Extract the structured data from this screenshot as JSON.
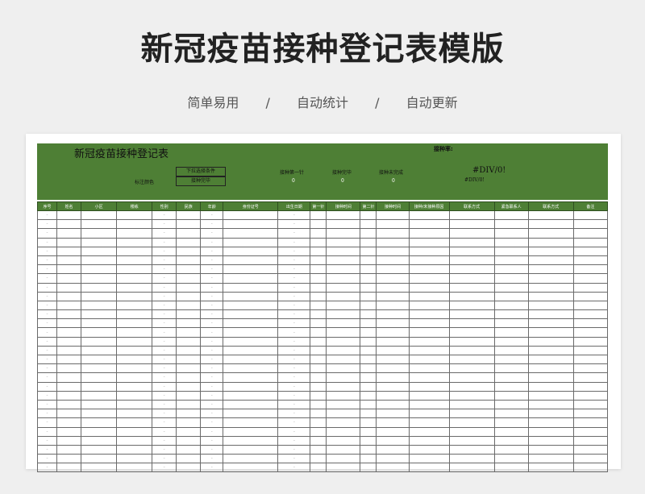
{
  "hero": {
    "title": "新冠疫苗接种登记表模版",
    "features": [
      "简单易用",
      "/",
      "自动统计",
      "/",
      "自动更新"
    ]
  },
  "sheet": {
    "title": "新冠疫苗接种登记表",
    "rate_label": "接种率:",
    "filter_label": "下拉选择条件",
    "mark_label": "标注颜色",
    "status_value": "接种完毕",
    "stats": [
      {
        "label": "接种第一针",
        "value": "0"
      },
      {
        "label": "接种完毕",
        "value": "0"
      },
      {
        "label": "接种未完成",
        "value": "0"
      }
    ],
    "rate_error_big": "#DIV/0!",
    "rate_error_small": "#DIV/0!"
  },
  "table": {
    "columns": [
      "序号",
      "姓名",
      "小区",
      "楼栋",
      "性别",
      "民族",
      "年龄",
      "身份证号",
      "出生日期",
      "第一针",
      "接种时间",
      "第二针",
      "接种时间",
      "接种/未接种原因",
      "联系方式",
      "紧急联系人",
      "联系方式",
      "备注"
    ],
    "placeholder": "–",
    "placeholder_cols": [
      0,
      4,
      6,
      8
    ],
    "row_count": 29
  },
  "colors": {
    "banner_green": "#4e7f35",
    "background": "#efefef"
  }
}
